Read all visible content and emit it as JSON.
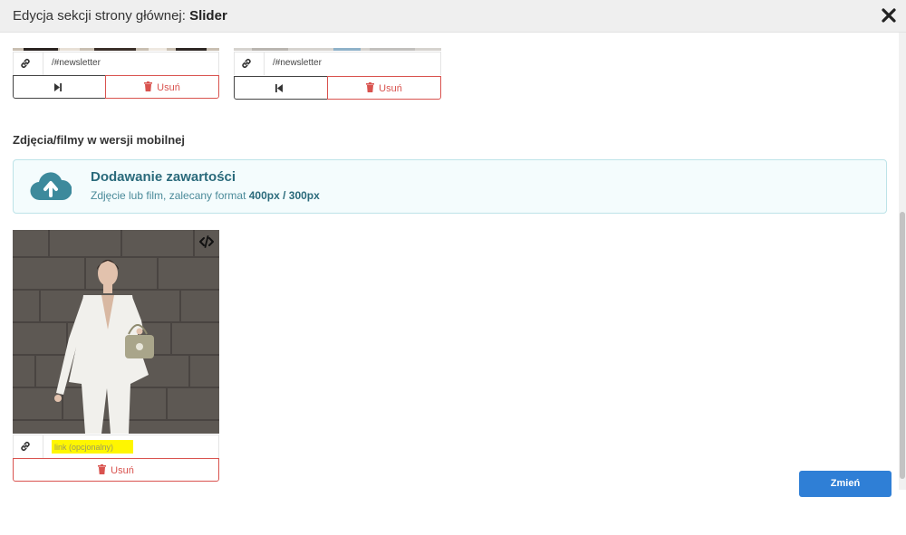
{
  "header": {
    "title_prefix": "Edycja sekcji strony głównej:",
    "title_bold": "Slider",
    "close_icon": "close-icon"
  },
  "desktop_cards": [
    {
      "link": "/#newsletter",
      "nav_icon": "skip-next-icon",
      "delete_label": "Usuń"
    },
    {
      "link": "/#newsletter",
      "nav_icon": "skip-previous-icon",
      "delete_label": "Usuń"
    }
  ],
  "mobile_section": {
    "title": "Zdjęcia/filmy w wersji mobilnej",
    "upload": {
      "icon": "cloud-upload-icon",
      "title": "Dodawanie zawartości",
      "subtitle_prefix": "Zdjęcie lub film, zalecany format",
      "subtitle_format": "400px / 300px"
    },
    "items": [
      {
        "link_placeholder": "link (opcjonalny)",
        "link_value": "",
        "delete_label": "Usuń",
        "code_icon": "code-icon"
      }
    ]
  },
  "footer": {
    "submit_label": "Zmień"
  },
  "colors": {
    "accent": "#2f7fd6",
    "danger": "#d9534f",
    "upload_bg": "#f4fcfd",
    "highlight": "#fff600"
  }
}
